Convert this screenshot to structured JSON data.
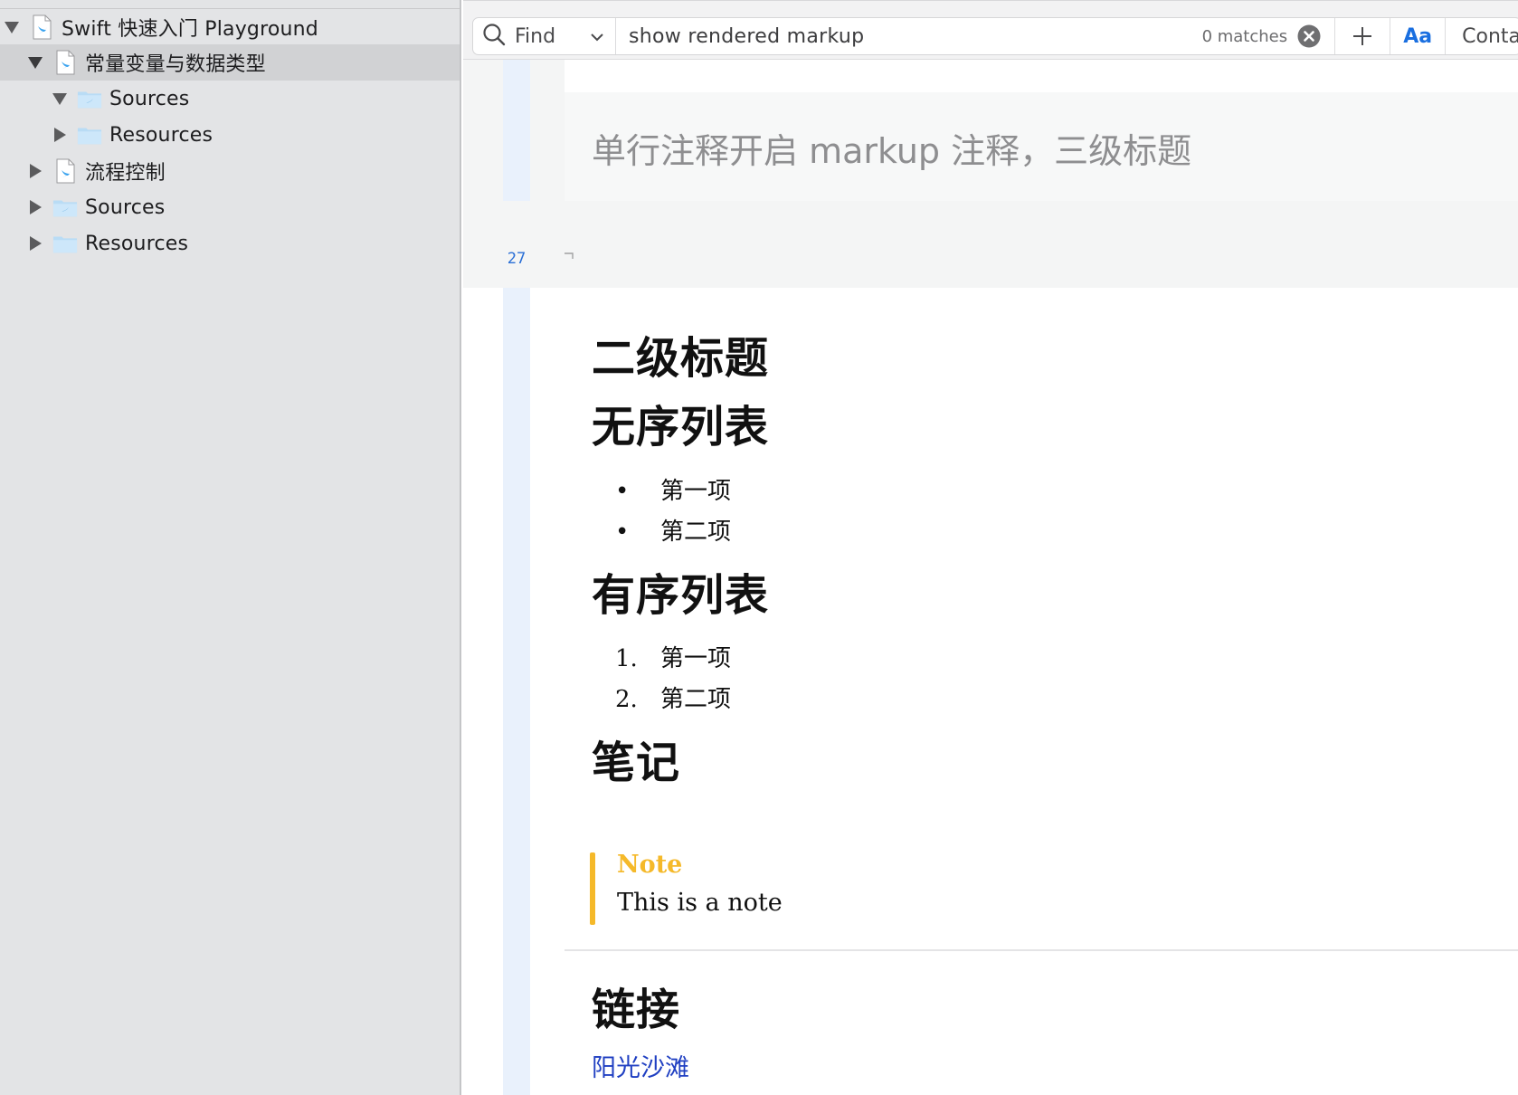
{
  "navigator": {
    "items": [
      {
        "label": "Swift 快速入门 Playground",
        "icon": "playground-file-icon",
        "expanded": true,
        "selected": false
      },
      {
        "label": "常量变量与数据类型",
        "icon": "swift-file-icon",
        "expanded": true,
        "selected": true
      },
      {
        "label": "Sources",
        "icon": "folder-icon",
        "expanded": true,
        "selected": false
      },
      {
        "label": "Resources",
        "icon": "folder-icon",
        "expanded": false,
        "selected": false
      },
      {
        "label": "流程控制",
        "icon": "swift-file-icon",
        "expanded": false,
        "selected": false
      },
      {
        "label": "Sources",
        "icon": "folder-icon",
        "expanded": false,
        "selected": false
      },
      {
        "label": "Resources",
        "icon": "folder-icon",
        "expanded": false,
        "selected": false
      }
    ]
  },
  "find_bar": {
    "mode": "Find",
    "query": "show rendered markup",
    "matches": "0 matches",
    "case_toggle": "Aa",
    "match_mode": "Conta"
  },
  "editor": {
    "line_number": "27",
    "heading3": "单行注释开启 markup 注释，三级标题",
    "heading2": "二级标题",
    "unordered_heading": "无序列表",
    "unordered_items": [
      {
        "marker": "•",
        "text": "第一项"
      },
      {
        "marker": "•",
        "text": "第二项"
      }
    ],
    "ordered_heading": "有序列表",
    "ordered_items": [
      {
        "marker": "1.",
        "text": "第一项"
      },
      {
        "marker": "2.",
        "text": "第二项"
      }
    ],
    "notes_heading": "笔记",
    "note": {
      "title": "Note",
      "text": "This is a note"
    },
    "links_heading": "链接",
    "link_text": "阳光沙滩"
  },
  "colors": {
    "sidebar_bg": "#e3e4e6",
    "selected_row": "#d1d2d4",
    "gutter": "#e9f1fc",
    "accent_blue": "#1a6fe0",
    "note_yellow": "#f5b92a",
    "link_blue": "#1f3fc2"
  }
}
